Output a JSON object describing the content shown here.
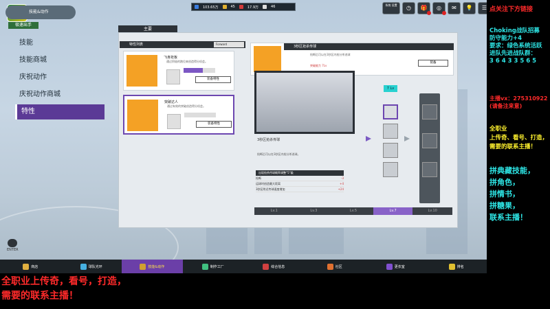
{
  "app": {
    "title": "技能&动作",
    "logo_sub": "极速出手"
  },
  "currency": {
    "a": "103.65万",
    "b": "45",
    "c": "17.9万",
    "d": "46"
  },
  "top_icons": [
    {
      "name": "settings-label-icon",
      "label": "系统\n设置"
    },
    {
      "name": "clock-icon",
      "label": "◷"
    },
    {
      "name": "gift-icon",
      "label": "🎁"
    },
    {
      "name": "target-icon",
      "label": "◎"
    },
    {
      "name": "mail-icon",
      "label": "✉"
    },
    {
      "name": "bulb-icon",
      "label": "💡"
    },
    {
      "name": "menu-icon",
      "label": "☰"
    }
  ],
  "nav": [
    "技能",
    "技能商城",
    "庆祝动作",
    "庆祝动作商城",
    "特性"
  ],
  "panel_tab": "主要",
  "list": {
    "header": "特性列表",
    "select": "Forward"
  },
  "cards": [
    {
      "name": "飞身抢板",
      "desc": "通过积极的跑位来创造得分机会。",
      "button": "装备特性"
    },
    {
      "name": "突破达人",
      "desc": "通过有效的突破创造得分机会。",
      "button": "装备特性"
    }
  ],
  "detail": {
    "header": "3秒区抢杀传球",
    "sub": "抢断后可以在3秒区内抢分杀进球",
    "tag": "突破能力 7Lv",
    "button": "装备"
  },
  "video": {
    "title": "3秒区抢杀传球",
    "desc": "抢断后可以在3秒区内抢分杀进球。"
  },
  "stats": {
    "head": "出现抢杀传球概率调整“5”级",
    "rows": [
      {
        "k": "抢断",
        "v": "-3"
      },
      {
        "k": "运球时创造最大距离",
        "v": "+4"
      },
      {
        "k": "3秒区附近传球速度增加",
        "v": "+24"
      }
    ]
  },
  "levels": [
    "Lv.1",
    "Lv.3",
    "Lv.5",
    "Lv.7",
    "Lv.10"
  ],
  "level_current": 3,
  "level_badge": "7 Lv",
  "bottom": [
    {
      "name": "商店",
      "color": "#e0b040"
    },
    {
      "name": "球队光环",
      "color": "#46b0e0"
    },
    {
      "name": "技能&动作",
      "color": "#d0a030"
    },
    {
      "name": "制作工厂",
      "color": "#40c080"
    },
    {
      "name": "综合信息",
      "color": "#d04040"
    },
    {
      "name": "社区",
      "color": "#e07030"
    },
    {
      "name": "更衣室",
      "color": "#8050d0"
    },
    {
      "name": "排名",
      "color": "#e0c030"
    }
  ],
  "enter_label": "ENTER",
  "overlay": {
    "right1": "点关注下方链接",
    "right2": "Choking战队招募\n防守能力+4\n要求：绿色系统活跃\n进队先进战队群：\n3 6 4 3 3 5 6 5",
    "right3": "主播vx：275310922\n(请备注来意)",
    "right4": "全职业\n上传奇、看号、打造，\n需要的联系主播！",
    "right5": "拼典藏技能，\n拼角色，\n拼情书，\n拼糖果，\n联系主播！",
    "bottom": "全职业上传奇，看号，打造，\n需要的联系主播！"
  },
  "colors": {
    "accent": "#6b3fa8",
    "overlay_red": "#ff2a2a",
    "overlay_cyan": "#2ee6e6",
    "overlay_yellow": "#fff22e"
  }
}
